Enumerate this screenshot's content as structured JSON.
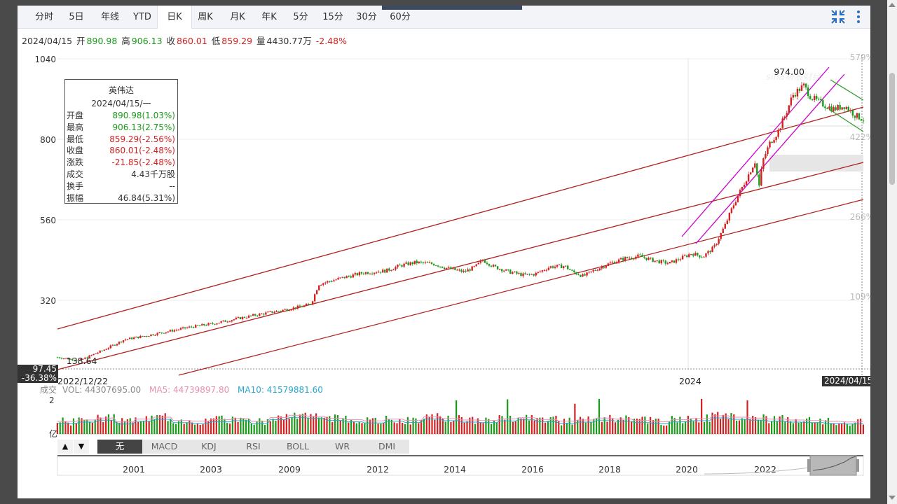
{
  "tabs": [
    {
      "label": "分时",
      "active": false
    },
    {
      "label": "5日",
      "active": false
    },
    {
      "label": "年线",
      "active": false
    },
    {
      "label": "YTD",
      "active": false
    },
    {
      "label": "日K",
      "active": true
    },
    {
      "label": "周K",
      "active": false
    },
    {
      "label": "月K",
      "active": false
    },
    {
      "label": "年K",
      "active": false
    },
    {
      "label": "5分",
      "active": false
    },
    {
      "label": "15分",
      "active": false
    },
    {
      "label": "30分",
      "active": false
    },
    {
      "label": "60分",
      "active": false
    }
  ],
  "toolbar": {
    "collapse_icon": "collapse-arrows-icon",
    "menu_icon": "more-vertical-icon"
  },
  "info": {
    "date": "2024/04/15",
    "open_label": "开",
    "open": "890.98",
    "high_label": "高",
    "high": "906.13",
    "close_label": "收",
    "close": "860.01",
    "low_label": "低",
    "low": "859.29",
    "vol_label": "量",
    "vol": "4430.77万",
    "change": "-2.48%"
  },
  "tooltip": {
    "name": "英伟达",
    "date": "2024/04/15/一",
    "rows": [
      {
        "k": "开盘",
        "v": "890.98(1.03%)",
        "c": "up"
      },
      {
        "k": "最高",
        "v": "906.13(2.75%)",
        "c": "up"
      },
      {
        "k": "最低",
        "v": "859.29(-2.56%)",
        "c": "down"
      },
      {
        "k": "收盘",
        "v": "860.01(-2.48%)",
        "c": "down"
      },
      {
        "k": "涨跌",
        "v": "-21.85(-2.48%)",
        "c": "down"
      },
      {
        "k": "成交",
        "v": "4.43千万股",
        "c": "dk"
      },
      {
        "k": "换手",
        "v": "--",
        "c": "dk"
      },
      {
        "k": "振幅",
        "v": "46.84(5.31%)",
        "c": "dk"
      }
    ]
  },
  "badges": {
    "left_price": "97.45",
    "left_pct": "-36.38%",
    "end_date": "2024/04/15"
  },
  "volume_legend": {
    "label": "成交",
    "vol": "VOL: 44307695.00",
    "ma5": "MA5: 44739897.80",
    "ma10": "MA10: 41579881.60"
  },
  "volume_axis": {
    "top": "2",
    "unit": "亿"
  },
  "indicators": {
    "up": "▲",
    "down": "▼",
    "buttons": [
      "无",
      "MACD",
      "KDJ",
      "RSI",
      "BOLL",
      "WR",
      "DMI"
    ],
    "active": "无"
  },
  "colors": {
    "up": "#d42020",
    "down": "#1a9a1a",
    "channel": "#b22222",
    "wedge": "#cc00cc",
    "trend": "#2d9d2d",
    "ma5": "#e78fb3",
    "ma10": "#2aa6c9"
  },
  "chart_data": {
    "type": "candlestick",
    "price_axis": {
      "ticks": [
        "1040",
        "800",
        "560",
        "320"
      ]
    },
    "pct_axis": {
      "ticks": [
        "579%",
        "422%",
        "266%",
        "109%"
      ]
    },
    "x_axis": {
      "start": "2022/12/22",
      "mid": "2024",
      "end": "2024/04/15"
    },
    "annotations": {
      "high": "974.00",
      "low": "138.64"
    },
    "price_path": [
      [
        0.0,
        150
      ],
      [
        0.03,
        141
      ],
      [
        0.06,
        170
      ],
      [
        0.09,
        203
      ],
      [
        0.12,
        215
      ],
      [
        0.15,
        228
      ],
      [
        0.18,
        241
      ],
      [
        0.21,
        251
      ],
      [
        0.24,
        265
      ],
      [
        0.27,
        278
      ],
      [
        0.3,
        290
      ],
      [
        0.33,
        303
      ],
      [
        0.34,
        310
      ],
      [
        0.35,
        368
      ],
      [
        0.38,
        386
      ],
      [
        0.41,
        402
      ],
      [
        0.44,
        408
      ],
      [
        0.46,
        424
      ],
      [
        0.48,
        433
      ],
      [
        0.505,
        428
      ],
      [
        0.525,
        414
      ],
      [
        0.545,
        405
      ],
      [
        0.56,
        420
      ],
      [
        0.57,
        440
      ],
      [
        0.585,
        420
      ],
      [
        0.605,
        405
      ],
      [
        0.625,
        395
      ],
      [
        0.64,
        398
      ],
      [
        0.66,
        420
      ],
      [
        0.68,
        422
      ],
      [
        0.69,
        405
      ],
      [
        0.705,
        392
      ],
      [
        0.72,
        410
      ],
      [
        0.74,
        430
      ],
      [
        0.76,
        445
      ],
      [
        0.78,
        452
      ],
      [
        0.8,
        438
      ],
      [
        0.82,
        430
      ],
      [
        0.835,
        445
      ],
      [
        0.85,
        460
      ],
      [
        0.865,
        450
      ],
      [
        0.88,
        478
      ],
      [
        0.895,
        545
      ],
      [
        0.905,
        600
      ],
      [
        0.915,
        645
      ],
      [
        0.925,
        690
      ],
      [
        0.935,
        735
      ],
      [
        0.94,
        655
      ],
      [
        0.945,
        735
      ],
      [
        0.955,
        790
      ],
      [
        0.965,
        820
      ],
      [
        0.975,
        870
      ],
      [
        0.985,
        930
      ],
      [
        0.992,
        945
      ],
      [
        1.0,
        960
      ],
      [
        1.01,
        925
      ],
      [
        1.025,
        905
      ],
      [
        1.04,
        890
      ],
      [
        1.055,
        900
      ],
      [
        1.07,
        870
      ],
      [
        1.08,
        860
      ]
    ],
    "volume_profile": [
      0.3,
      0.35,
      0.42,
      0.28,
      0.38,
      0.45,
      0.33,
      0.31,
      0.36,
      0.4,
      0.3,
      0.44,
      0.52,
      0.48,
      0.41,
      0.36,
      0.32,
      0.38,
      0.34,
      0.46,
      0.4,
      0.35,
      0.33,
      0.39,
      0.43,
      0.37,
      0.31,
      0.35,
      0.42,
      0.38,
      0.33,
      0.29,
      0.36,
      0.4,
      0.5,
      0.45,
      0.42,
      0.38,
      0.35,
      0.33,
      0.3,
      0.28,
      0.31
    ]
  },
  "navigator": {
    "years": [
      "2001",
      "2003",
      "2009",
      "2012",
      "2014",
      "2016",
      "2018",
      "2020",
      "2022"
    ]
  }
}
